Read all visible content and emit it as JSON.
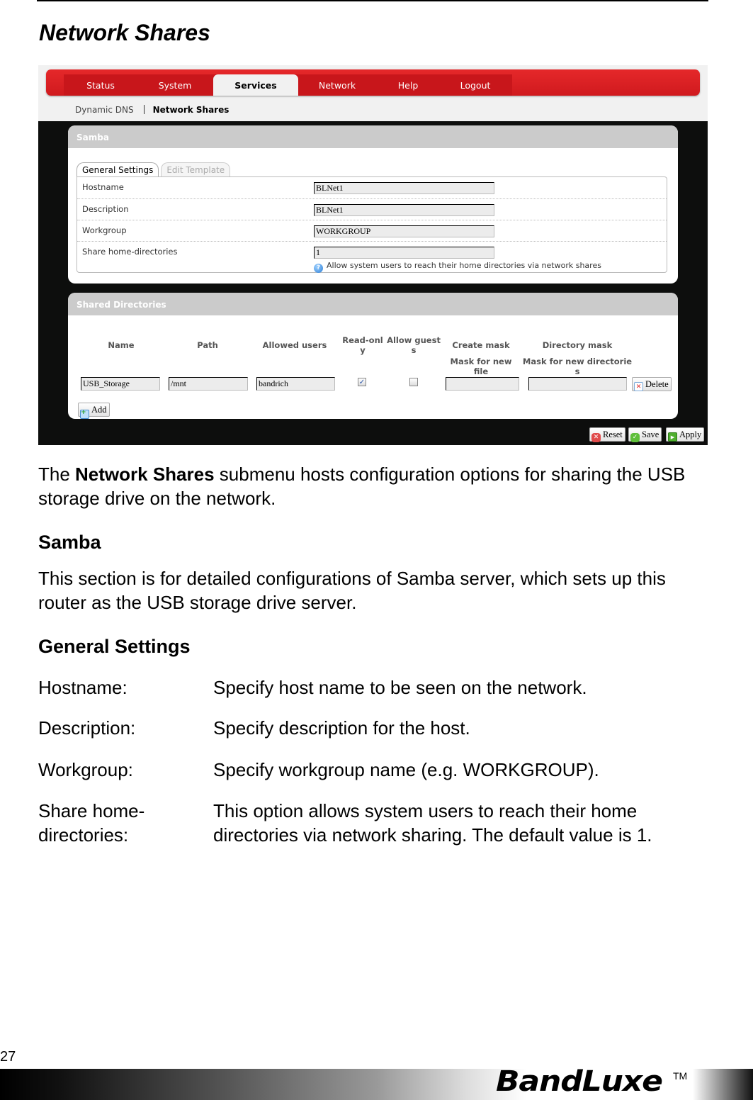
{
  "page": {
    "title": "Network Shares",
    "page_number": "27",
    "brand": "BandLuxe",
    "trademark": "TM"
  },
  "router_ui": {
    "menu": [
      {
        "label": "Status",
        "active": false
      },
      {
        "label": "System",
        "active": false
      },
      {
        "label": "Services",
        "active": true
      },
      {
        "label": "Network",
        "active": false
      },
      {
        "label": "Help",
        "active": false
      },
      {
        "label": "Logout",
        "active": false
      }
    ],
    "submenu": [
      {
        "label": "Dynamic DNS",
        "active": false
      },
      {
        "label": "Network Shares",
        "active": true
      }
    ],
    "samba": {
      "title": "Samba",
      "tabs": [
        {
          "label": "General Settings",
          "active": true
        },
        {
          "label": "Edit Template",
          "active": false
        }
      ],
      "fields": [
        {
          "label": "Hostname",
          "value": "BLNet1"
        },
        {
          "label": "Description",
          "value": "BLNet1"
        },
        {
          "label": "Workgroup",
          "value": "WORKGROUP"
        },
        {
          "label": "Share home-directories",
          "value": "1",
          "hint": "Allow system users to reach their home directories via network shares"
        }
      ]
    },
    "shared_directories": {
      "title": "Shared Directories",
      "columns": {
        "name": "Name",
        "path": "Path",
        "allowed_users": "Allowed users",
        "read_only_1": "Read-onl",
        "read_only_2": "y",
        "allow_guests_1": "Allow guest",
        "allow_guests_2": "s",
        "create_mask": "Create mask",
        "create_mask_sub_1": "Mask for new file",
        "create_mask_sub_2": "s",
        "dir_mask": "Directory mask",
        "dir_mask_sub_1": "Mask for new directorie",
        "dir_mask_sub_2": "s"
      },
      "rows": [
        {
          "name": "USB_Storage",
          "path": "/mnt",
          "allowed_users": "bandrich",
          "read_only": true,
          "allow_guests": false,
          "create_mask": "",
          "dir_mask": "",
          "delete_label": "Delete"
        }
      ],
      "add_label": "Add"
    },
    "buttons": {
      "reset": "Reset",
      "save": "Save",
      "apply": "Apply"
    }
  },
  "body": {
    "intro_prefix": "The ",
    "intro_bold": "Network Shares",
    "intro_rest": " submenu hosts configuration options for sharing the USB storage drive on the network.",
    "samba_heading": "Samba",
    "samba_text": "This section is for detailed configurations of Samba server, which sets up this router as the USB storage drive server.",
    "general_heading": "General Settings",
    "definitions": [
      {
        "term": "Hostname:",
        "desc": "Specify host name to be seen on the network."
      },
      {
        "term": "Description:",
        "desc": "Specify description for the host."
      },
      {
        "term": "Workgroup:",
        "desc": "Specify workgroup name (e.g. WORKGROUP)."
      },
      {
        "term": "Share home-directories:",
        "desc": "This option allows system users to reach their home directories via network sharing. The default value is 1."
      }
    ]
  }
}
